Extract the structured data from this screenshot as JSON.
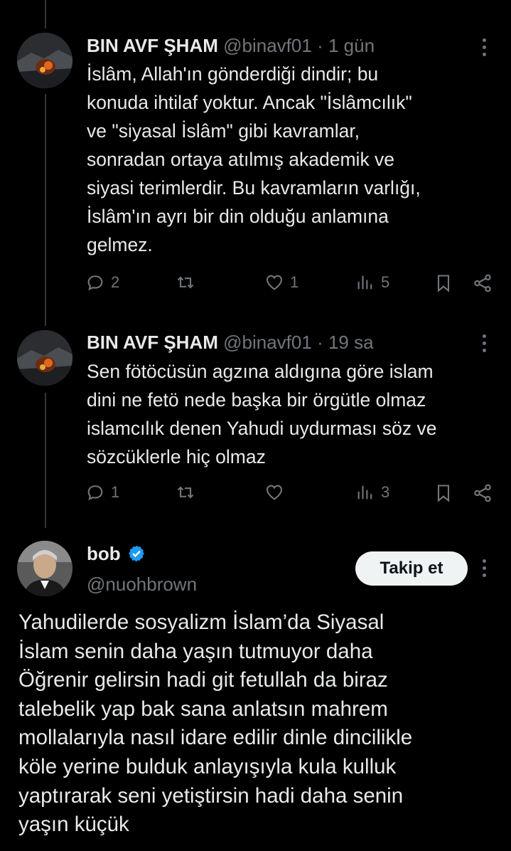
{
  "tweets": [
    {
      "name": "BIN AVF ŞHAM",
      "handle": "@binavf01",
      "time": "1 gün",
      "lines": [
        "İslâm, Allah'ın gönderdiği dindir; bu",
        "konuda ihtilaf yoktur. Ancak \"İslâmcılık\"",
        "ve \"siyasal İslâm\" gibi kavramlar,",
        "sonradan ortaya atılmış akademik ve",
        "siyasi terimlerdir. Bu kavramların varlığı,",
        "İslâm'ın ayrı bir din olduğu anlamına",
        "gelmez."
      ],
      "replies": "2",
      "retweets": "",
      "likes": "1",
      "views": "5"
    },
    {
      "name": "BIN AVF ŞHAM",
      "handle": "@binavf01",
      "time": "19 sa",
      "lines": [
        "Sen fötöcüsün agzına aldıgına göre islam",
        "dini ne fetö nede başka bir örgütle olmaz",
        "islamcılık denen Yahudi uydurması söz ve",
        "sözcüklerle hiç olmaz"
      ],
      "replies": "1",
      "retweets": "",
      "likes": "",
      "views": "3"
    }
  ],
  "main": {
    "name": "bob",
    "handle": "@nuohbrown",
    "follow_label": "Takip et",
    "verified_color": "#1d9bf0",
    "lines": [
      "Yahudilerde sosyalizm İslam’da Siyasal",
      "İslam senin daha yaşın tutmuyor daha",
      "Öğrenir gelirsin hadi git fetullah da biraz",
      "talebelik yap bak sana anlatsın mahrem",
      "mollalarıyla nasıl idare edilir dinle dincilikle",
      "köle yerine bulduk anlayışıyla kula kulluk",
      "yaptırarak seni yetiştirsin hadi daha senin",
      "yaşın küçük"
    ]
  }
}
